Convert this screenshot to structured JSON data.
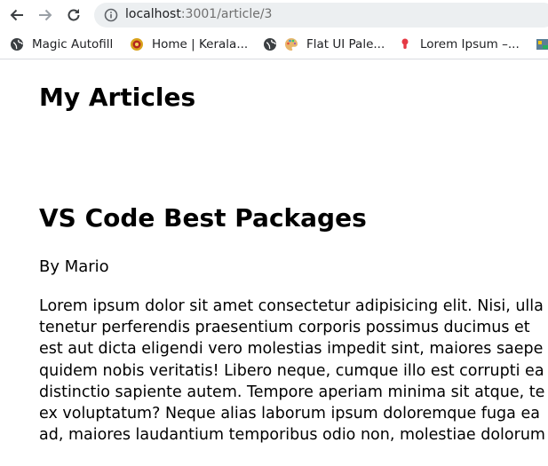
{
  "browser": {
    "url_host": "localhost",
    "url_path": ":3001/article/3"
  },
  "bookmarks": [
    {
      "label": "Magic Autofill",
      "icon": "globe-icon"
    },
    {
      "label": "Home | Kerala...",
      "icon": "kerala-logo-icon"
    },
    {
      "label": "",
      "icon": "globe-icon"
    },
    {
      "label": "Flat UI Pale...",
      "icon": "palette-icon"
    },
    {
      "label": "Lorem Ipsum –...",
      "icon": "lorem-logo-icon"
    }
  ],
  "page": {
    "title": "My Articles",
    "article_title": "VS Code Best Packages",
    "byline": "By Mario",
    "body_lines": [
      "Lorem ipsum dolor sit amet consectetur adipisicing elit. Nisi, ulla",
      "tenetur perferendis praesentium corporis possimus ducimus et",
      "est aut dicta eligendi vero molestias impedit sint, maiores saepe",
      "quidem nobis veritatis! Libero neque, cumque illo est corrupti ea",
      "distinctio sapiente autem. Tempore aperiam minima sit atque, te",
      "ex voluptatum? Neque alias laborum ipsum doloremque fuga ea",
      "ad, maiores laudantium temporibus odio non, molestiae dolorum"
    ]
  },
  "colors": {
    "address_bar": "#eceff1",
    "bookmark_border": "#dadce0"
  }
}
